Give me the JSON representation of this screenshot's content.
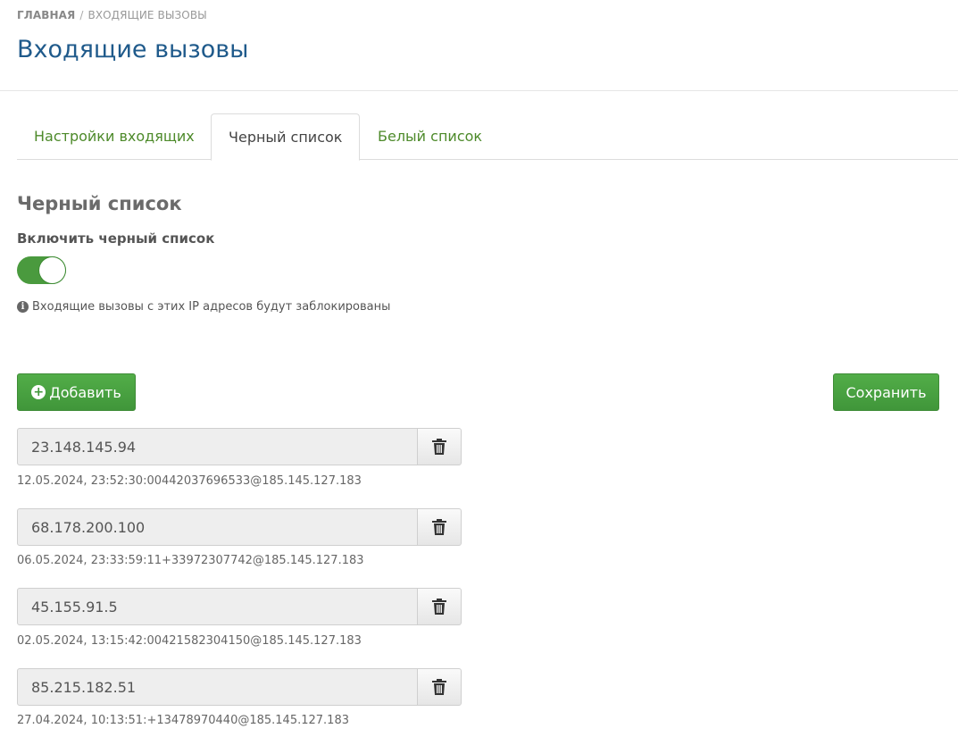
{
  "breadcrumb": {
    "home": "ГЛАВНАЯ",
    "separator": "/",
    "current": "ВХОДЯЩИЕ ВЫЗОВЫ"
  },
  "page_title": "Входящие вызовы",
  "tabs": [
    {
      "label": "Настройки входящих",
      "active": false
    },
    {
      "label": "Черный список",
      "active": true
    },
    {
      "label": "Белый список",
      "active": false
    }
  ],
  "section": {
    "title": "Черный список",
    "toggle_label": "Включить черный список",
    "toggle_on": true,
    "info_icon": "info-circle-icon",
    "info_text": "Входящие вызовы с этих IP адресов будут заблокированы"
  },
  "buttons": {
    "add_label": "Добавить",
    "save_label": "Сохранить"
  },
  "entries": [
    {
      "ip": "23.148.145.94",
      "meta": "12.05.2024, 23:52:30:00442037696533@185.145.127.183"
    },
    {
      "ip": "68.178.200.100",
      "meta": "06.05.2024, 23:33:59:11+33972307742@185.145.127.183"
    },
    {
      "ip": "45.155.91.5",
      "meta": "02.05.2024, 13:15:42:00421582304150@185.145.127.183"
    },
    {
      "ip": "85.215.182.51",
      "meta": "27.04.2024, 10:13:51:+13478970440@185.145.127.183"
    }
  ],
  "colors": {
    "accent_green": "#4aa341",
    "title_blue": "#1f5a8b",
    "tab_green": "#4d8a2a"
  }
}
